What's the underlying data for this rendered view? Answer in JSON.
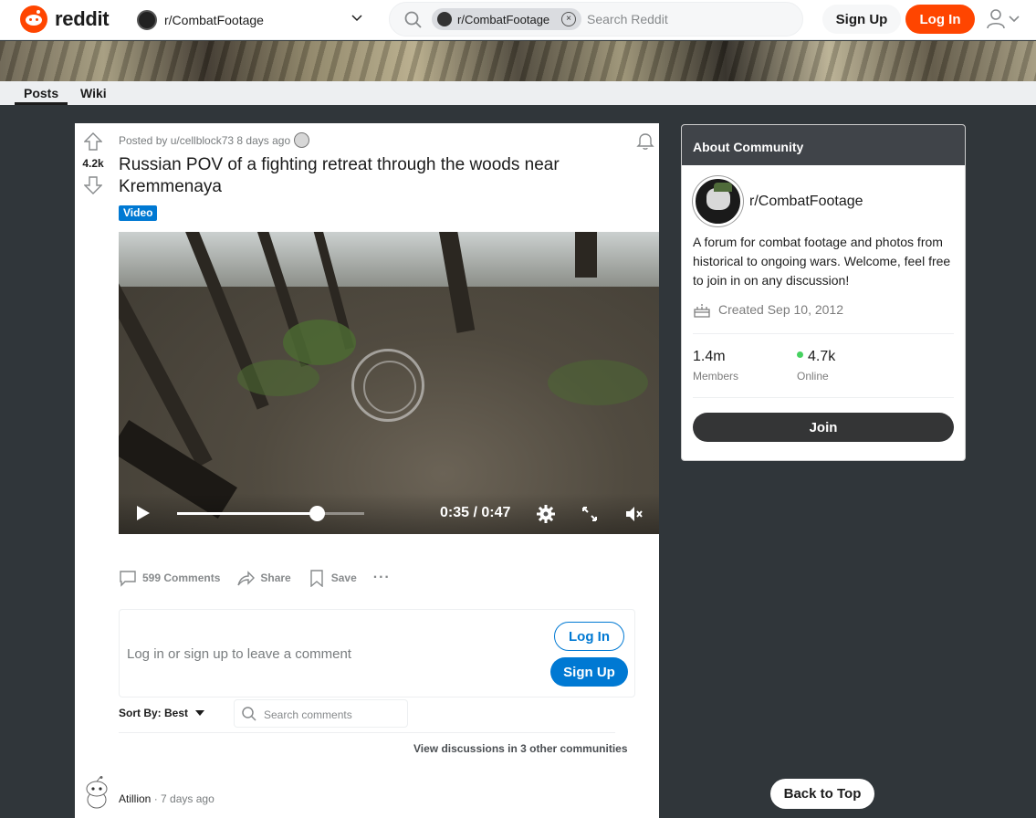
{
  "header": {
    "logo_text": "reddit",
    "community": "r/CombatFootage",
    "search": {
      "chip": "r/CombatFootage",
      "placeholder": "Search Reddit"
    },
    "signup_label": "Sign Up",
    "login_label": "Log In"
  },
  "tabs": [
    {
      "label": "Posts"
    },
    {
      "label": "Wiki"
    }
  ],
  "post": {
    "votes": "4.2k",
    "meta": "Posted by u/cellblock73 8 days ago",
    "title": "Russian POV of a fighting retreat through the woods near Kremmenaya",
    "flair": "Video",
    "video": {
      "time": "0:35 / 0:47",
      "progress": 0.745
    },
    "actions": {
      "comments": "599 Comments",
      "share": "Share",
      "save": "Save",
      "more": "···"
    },
    "comment_box": {
      "prompt": "Log in or sign up to leave a comment",
      "login": "Log In",
      "signup": "Sign Up"
    },
    "sort_label": "Sort By: Best",
    "comment_search_placeholder": "Search comments",
    "view_discussions": "View discussions in 3 other communities",
    "first_comment": {
      "author": "Atillion",
      "time": "· 7 days ago"
    }
  },
  "about": {
    "heading": "About Community",
    "name": "r/CombatFootage",
    "description": "A forum for combat footage and photos from historical to ongoing wars. Welcome, feel free to join in on any discussion!",
    "created": "Created Sep 10, 2012",
    "members": {
      "value": "1.4m",
      "label": "Members"
    },
    "online": {
      "value": "4.7k",
      "label": "Online"
    },
    "join_label": "Join"
  },
  "back_to_top": "Back to Top",
  "colors": {
    "brand": "#ff4500",
    "accent": "#0079d3",
    "online": "#46d160"
  }
}
